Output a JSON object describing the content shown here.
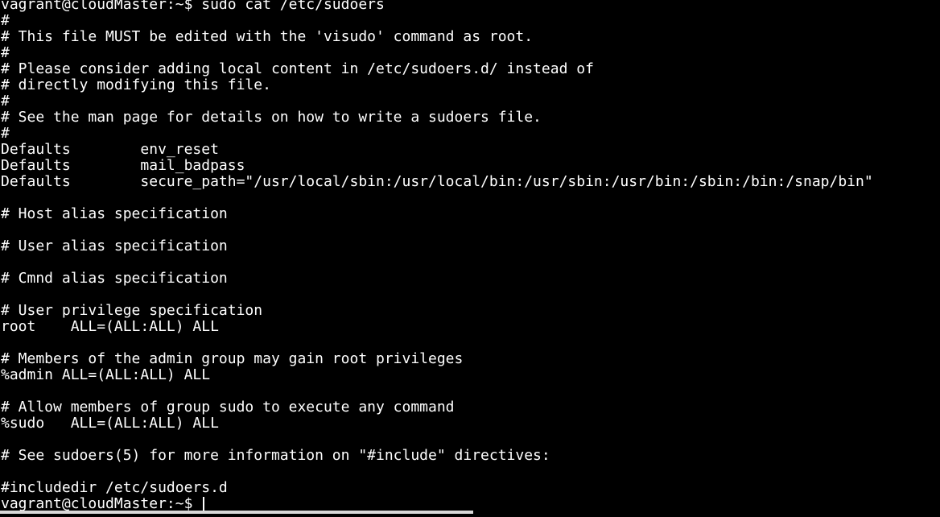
{
  "terminal": {
    "lines": [
      "vagrant@cloudMaster:~$ sudo cat /etc/sudoers",
      "#",
      "# This file MUST be edited with the 'visudo' command as root.",
      "#",
      "# Please consider adding local content in /etc/sudoers.d/ instead of",
      "# directly modifying this file.",
      "#",
      "# See the man page for details on how to write a sudoers file.",
      "#",
      "Defaults        env_reset",
      "Defaults        mail_badpass",
      "Defaults        secure_path=\"/usr/local/sbin:/usr/local/bin:/usr/sbin:/usr/bin:/sbin:/bin:/snap/bin\"",
      "",
      "# Host alias specification",
      "",
      "# User alias specification",
      "",
      "# Cmnd alias specification",
      "",
      "# User privilege specification",
      "root    ALL=(ALL:ALL) ALL",
      "",
      "# Members of the admin group may gain root privileges",
      "%admin ALL=(ALL:ALL) ALL",
      "",
      "# Allow members of group sudo to execute any command",
      "%sudo   ALL=(ALL:ALL) ALL",
      "",
      "# See sudoers(5) for more information on \"#include\" directives:",
      "",
      "#includedir /etc/sudoers.d"
    ],
    "prompt": "vagrant@cloudMaster:~$ "
  },
  "colors": {
    "background": "#000000",
    "foreground": "#ffffff"
  }
}
